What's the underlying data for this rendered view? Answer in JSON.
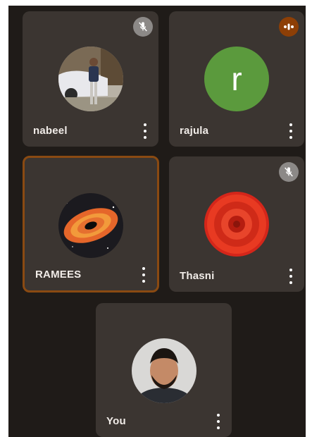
{
  "participants": [
    {
      "name": "nabeel",
      "muted": true,
      "speaking": false,
      "avatar": "photo-man-with-car"
    },
    {
      "name": "rajula",
      "muted": false,
      "speaking": true,
      "avatar_letter": "r",
      "avatar_color": "#5b9a3d"
    },
    {
      "name": "RAMEES",
      "muted": false,
      "speaking": false,
      "active": true,
      "avatar": "black-hole-illustration"
    },
    {
      "name": "Thasni",
      "muted": true,
      "speaking": false,
      "avatar": "red-dahlia-flower"
    },
    {
      "name": "You",
      "muted": false,
      "speaking": false,
      "avatar": "photo-bearded-man"
    }
  ],
  "icons": {
    "mute": "mic-off-icon",
    "speaking": "audio-level-icon",
    "menu": "more-vert-icon"
  },
  "colors": {
    "background": "#1f1b18",
    "tile": "#3b3531",
    "active_border": "#8a4a12",
    "mute_badge": "#8c8987",
    "speaking_badge": "#8d3f06"
  }
}
